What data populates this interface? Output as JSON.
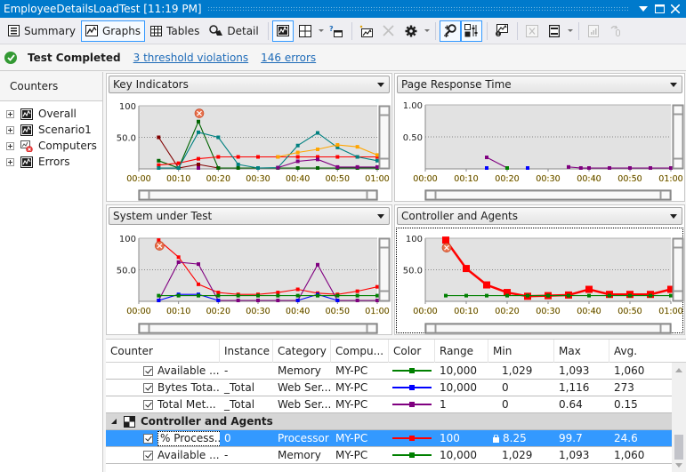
{
  "window": {
    "title": "EmployeeDetailsLoadTest [11:19 PM]",
    "controls": [
      "dropdown",
      "maximize",
      "close"
    ]
  },
  "toolbar": {
    "summary_label": "Summary",
    "graphs_label": "Graphs",
    "tables_label": "Tables",
    "detail_label": "Detail",
    "active_view": "Graphs",
    "icons": [
      "graph-view-icon",
      "layout-grid-icon",
      "help-panel-icon",
      "add-graph-icon",
      "delete-icon",
      "settings-gear-icon",
      "zoom-icon",
      "legend-toggle-icon",
      "export-graph-icon",
      "excel-icon",
      "report-icon",
      "trend-icon",
      "attach-icon"
    ]
  },
  "status": {
    "text": "Test Completed",
    "threshold_link": "3 threshold violations",
    "errors_link": "146 errors",
    "color": "#339933"
  },
  "counters": {
    "header": "Counters",
    "items": [
      {
        "label": "Overall",
        "icon": "graph-icon"
      },
      {
        "label": "Scenario1",
        "icon": "graph-icon"
      },
      {
        "label": "Computers",
        "icon": "computer-error-icon"
      },
      {
        "label": "Errors",
        "icon": "graph-icon"
      }
    ]
  },
  "panels": [
    {
      "title": "Key Indicators"
    },
    {
      "title": "Page Response Time"
    },
    {
      "title": "System under Test"
    },
    {
      "title": "Controller and Agents"
    }
  ],
  "chart_data": [
    {
      "type": "line",
      "title": "Key Indicators",
      "x": [
        "00:05",
        "00:10",
        "00:15",
        "00:20",
        "00:25",
        "00:30",
        "00:35",
        "00:40",
        "00:45",
        "00:50",
        "00:55",
        "01:00"
      ],
      "xticks": [
        "00:00",
        "00:10",
        "00:20",
        "00:30",
        "00:40",
        "00:50",
        "01:00"
      ],
      "yticks": [
        "100",
        "50.0"
      ],
      "ylim": [
        0,
        100
      ],
      "grid": "dotted at 50",
      "threshold_marker": {
        "x": "00:15",
        "y": 88
      },
      "series": [
        {
          "name": "dark-red",
          "color": "#800000",
          "values": [
            50,
            0,
            7,
            0,
            null,
            null,
            null,
            null,
            null,
            null,
            null,
            null
          ]
        },
        {
          "name": "green",
          "color": "#006400",
          "values": [
            13,
            0,
            75,
            0,
            0,
            0,
            0,
            0,
            0,
            0,
            0,
            0
          ]
        },
        {
          "name": "red",
          "color": "#ff0000",
          "values": [
            6,
            9,
            16,
            19,
            19,
            19,
            19,
            19,
            19,
            19,
            19,
            19
          ]
        },
        {
          "name": "teal",
          "color": "#008080",
          "values": [
            0,
            0,
            58,
            50,
            7,
            0,
            2,
            37,
            57,
            34,
            19,
            13
          ]
        },
        {
          "name": "orange",
          "color": "#ffa500",
          "values": [
            null,
            null,
            null,
            null,
            null,
            null,
            19,
            26,
            31,
            38,
            35,
            22
          ]
        },
        {
          "name": "purple",
          "color": "#800080",
          "values": [
            null,
            null,
            0,
            null,
            null,
            null,
            2,
            12,
            15,
            3,
            3,
            3
          ]
        }
      ]
    },
    {
      "type": "line",
      "title": "Page Response Time",
      "x": [
        "00:15",
        "00:20",
        "00:25",
        "00:35",
        "00:38",
        "00:40",
        "00:45",
        "00:50",
        "00:55",
        "01:00"
      ],
      "xticks": [
        "00:00",
        "00:10",
        "00:20",
        "00:30",
        "00:40",
        "00:50",
        "01:00"
      ],
      "yticks": [
        "1.00",
        "0.50"
      ],
      "ylim": [
        0,
        1
      ],
      "grid": "dotted at 0.5",
      "series": [
        {
          "name": "purple",
          "color": "#800080",
          "values": [
            0.18,
            0.01,
            null,
            0.03,
            0.01,
            0.01,
            0.01,
            0.01,
            0.01,
            0.01
          ]
        },
        {
          "name": "green",
          "color": "#008000",
          "values": [
            null,
            0.01,
            null,
            null,
            null,
            null,
            null,
            null,
            null,
            null
          ]
        },
        {
          "name": "blue",
          "color": "#0000ff",
          "values": [
            0.01,
            null,
            0.01,
            null,
            null,
            null,
            null,
            null,
            null,
            null
          ]
        }
      ]
    },
    {
      "type": "line",
      "title": "System under Test",
      "x": [
        "00:05",
        "00:10",
        "00:15",
        "00:20",
        "00:25",
        "00:30",
        "00:35",
        "00:40",
        "00:45",
        "00:50",
        "00:55",
        "01:00"
      ],
      "xticks": [
        "00:00",
        "00:10",
        "00:20",
        "00:30",
        "00:40",
        "00:50",
        "01:00"
      ],
      "yticks": [
        "100",
        "50.0"
      ],
      "ylim": [
        0,
        100
      ],
      "grid": "dotted at 50",
      "threshold_marker": {
        "x": "00:05",
        "y": 88
      },
      "series": [
        {
          "name": "red",
          "color": "#ff0000",
          "values": [
            97,
            70,
            27,
            14,
            11,
            11,
            14,
            19,
            13,
            11,
            16,
            23
          ]
        },
        {
          "name": "purple",
          "color": "#800080",
          "values": [
            0,
            62,
            59,
            0,
            0,
            0,
            0,
            0,
            58,
            0,
            0,
            0
          ]
        },
        {
          "name": "blue",
          "color": "#0000ff",
          "values": [
            0,
            11,
            11,
            0,
            null,
            null,
            null,
            0,
            11,
            0,
            null,
            null
          ]
        },
        {
          "name": "green",
          "color": "#008000",
          "values": [
            9,
            9,
            9,
            9,
            9,
            9,
            9,
            9,
            9,
            9,
            9,
            9
          ]
        }
      ]
    },
    {
      "type": "line",
      "title": "Controller and Agents",
      "x": [
        "00:05",
        "00:10",
        "00:15",
        "00:20",
        "00:25",
        "00:30",
        "00:35",
        "00:40",
        "00:45",
        "00:50",
        "00:55",
        "01:00"
      ],
      "xticks": [
        "00:00",
        "00:10",
        "00:20",
        "00:30",
        "00:40",
        "00:50",
        "01:00"
      ],
      "yticks": [
        "100",
        "50.0"
      ],
      "ylim": [
        0,
        100
      ],
      "grid": "dotted at 50",
      "threshold_marker": {
        "x": "00:05",
        "y": 85
      },
      "series": [
        {
          "name": "% Processor Time",
          "color": "#ff0000",
          "bold": true,
          "values": [
            97,
            52,
            26,
            14,
            8,
            9,
            10,
            19,
            11,
            11,
            11,
            19
          ]
        },
        {
          "name": "Available MBytes",
          "color": "#008000",
          "values": [
            9,
            9,
            9,
            9,
            9,
            9,
            9,
            9,
            9,
            9,
            9,
            9
          ]
        }
      ]
    }
  ],
  "table": {
    "columns": [
      "Counter",
      "Instance",
      "Category",
      "Compu...",
      "Color",
      "Range",
      "Min",
      "Max",
      "Avg."
    ],
    "rows": [
      {
        "kind": "item",
        "counter": "Available ...",
        "instance": "-",
        "category": "Memory",
        "computer": "MY-PC",
        "color": "#008000",
        "range": "10,000",
        "min": "1,029",
        "max": "1,093",
        "avg": "1,060",
        "checked": true
      },
      {
        "kind": "item",
        "counter": "Bytes Tota...",
        "instance": "_Total",
        "category": "Web Ser...",
        "computer": "MY-PC",
        "color": "#0000ff",
        "range": "10,000",
        "min": "0",
        "max": "1,116",
        "avg": "273",
        "checked": true
      },
      {
        "kind": "item",
        "counter": "Total Met...",
        "instance": "_Total",
        "category": "Web Ser...",
        "computer": "MY-PC",
        "color": "#800080",
        "range": "1",
        "min": "0",
        "max": "0.64",
        "avg": "0.15",
        "checked": true
      },
      {
        "kind": "group",
        "counter": "Controller and Agents"
      },
      {
        "kind": "item",
        "selected": true,
        "counter": "% Process...",
        "instance": "0",
        "category": "Processor",
        "computer": "MY-PC",
        "color": "#ff0000",
        "range": "100",
        "min": "8.25",
        "max": "99.7",
        "avg": "24.6",
        "checked": true,
        "locked": true
      },
      {
        "kind": "item",
        "counter": "Available ...",
        "instance": "-",
        "category": "Memory",
        "computer": "MY-PC",
        "color": "#008000",
        "range": "10,000",
        "min": "1,029",
        "max": "1,093",
        "avg": "1,060",
        "checked": true
      }
    ]
  }
}
